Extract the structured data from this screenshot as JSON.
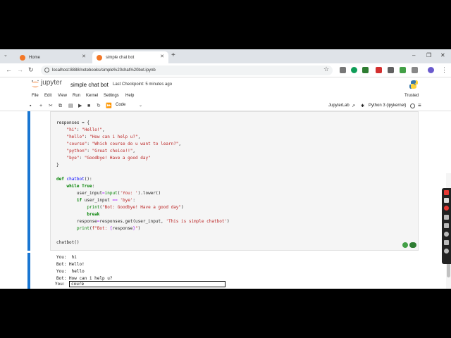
{
  "browser": {
    "tabs": [
      {
        "label": "Home",
        "active": false
      },
      {
        "label": "simple chat bot",
        "active": true
      }
    ],
    "url": "localhost:8888/notebooks/simple%20chat%20bot.ipynb"
  },
  "jupyter": {
    "logo_text": "jupyter",
    "notebook_title": "simple chat bot",
    "checkpoint": "Last Checkpoint: 5 minutes ago",
    "menu": [
      "File",
      "Edit",
      "View",
      "Run",
      "Kernel",
      "Settings",
      "Help"
    ],
    "trusted": "Trusted",
    "cell_type": "Code",
    "jupyterlab_link": "JupyterLab",
    "kernel": "Python 3 (ipykernel)"
  },
  "code_lines": [
    "responses = {",
    "    \"hi\": \"Hello!\",",
    "    \"hello\": \"How can i help u?\",",
    "    \"course\": \"Which course do u want to learn?\",",
    "    \"python\": \"Great choice!!\",",
    "    \"bye\": \"Goodbye! Have a good day\"",
    "}",
    "",
    "def chatbot():",
    "    while True:",
    "        user_input=input('You: ').lower()",
    "        if user_input == 'bye':",
    "            print(\"Bot: Goodbye! Have a good day\")",
    "            break",
    "        response=responses.get(user_input, 'This is simple chatbot')",
    "        print(f\"Bot: {response}\")",
    "",
    "chatbot()"
  ],
  "output_lines": [
    "You:  hi",
    "Bot: Hello!",
    "You:  hello",
    "Bot: How can i help u?"
  ],
  "stdin": {
    "prompt": "You: ",
    "value": "coure"
  },
  "colors": {
    "accent": "#1976d2",
    "keyword": "#008000",
    "string": "#ba2121",
    "function": "#0000ff"
  }
}
